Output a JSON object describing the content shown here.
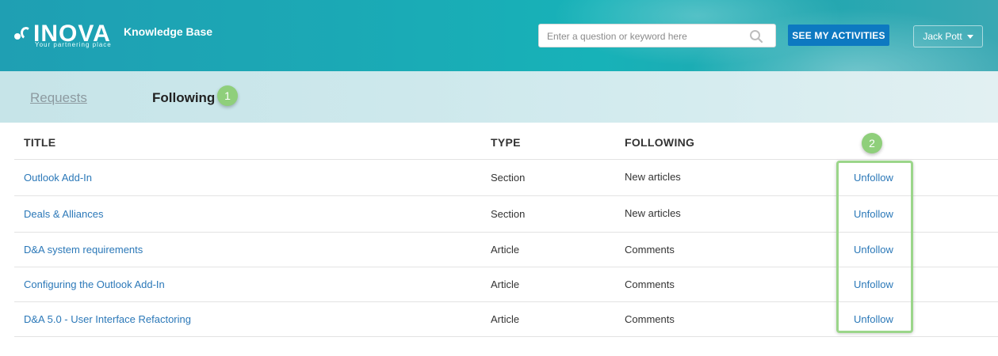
{
  "header": {
    "logo_text": "INOVA",
    "logo_tagline": "Your partnering place",
    "kb_title": "Knowledge Base",
    "search_placeholder": "Enter a question or keyword here",
    "activities_label": "SEE MY ACTIVITIES",
    "user_name": "Jack Pott"
  },
  "tabs": [
    {
      "label": "Requests",
      "active": false
    },
    {
      "label": "Following",
      "active": true
    }
  ],
  "badges": [
    "1",
    "2"
  ],
  "table": {
    "columns": [
      "TITLE",
      "TYPE",
      "FOLLOWING"
    ],
    "rows": [
      {
        "title": "Outlook Add-In",
        "type": "Section",
        "following": "New articles",
        "action": "Unfollow"
      },
      {
        "title": "Deals & Alliances",
        "type": "Section",
        "following": "New articles",
        "action": "Unfollow"
      },
      {
        "title": "D&A system requirements",
        "type": "Article",
        "following": "Comments",
        "action": "Unfollow"
      },
      {
        "title": "Configuring the Outlook Add-In",
        "type": "Article",
        "following": "Comments",
        "action": "Unfollow"
      },
      {
        "title": "D&A 5.0 - User Interface Refactoring",
        "type": "Article",
        "following": "Comments",
        "action": "Unfollow"
      }
    ]
  },
  "colors": {
    "accent": "#0d79c1",
    "link": "#2b78b8",
    "badge": "#8fcf7b"
  }
}
